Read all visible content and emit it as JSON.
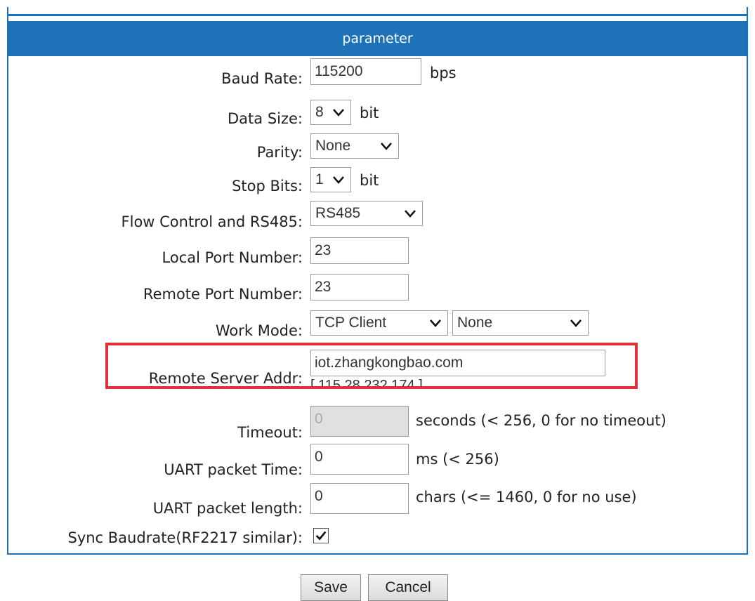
{
  "panel": {
    "title": "parameter"
  },
  "fields": {
    "baud_rate": {
      "label": "Baud Rate:",
      "value": "115200",
      "unit": "bps"
    },
    "data_size": {
      "label": "Data Size:",
      "value": "8",
      "unit": "bit"
    },
    "parity": {
      "label": "Parity:",
      "value": "None"
    },
    "stop_bits": {
      "label": "Stop Bits:",
      "value": "1",
      "unit": "bit"
    },
    "flow_control": {
      "label": "Flow Control and RS485:",
      "value": "RS485"
    },
    "local_port": {
      "label": "Local Port Number:",
      "value": "23"
    },
    "remote_port": {
      "label": "Remote Port Number:",
      "value": "23"
    },
    "work_mode": {
      "label": "Work Mode:",
      "value": "TCP Client",
      "secondary_value": "None"
    },
    "remote_server": {
      "label": "Remote Server Addr:",
      "value": "iot.zhangkongbao.com",
      "resolved": "[ 115.28.232.174 ]"
    },
    "timeout": {
      "label": "Timeout:",
      "value": "0",
      "unit": "seconds (< 256, 0 for no timeout)"
    },
    "uart_time": {
      "label": "UART packet Time:",
      "value": "0",
      "unit": "ms (< 256)"
    },
    "uart_length": {
      "label": "UART packet length:",
      "value": "0",
      "unit": "chars (<= 1460, 0 for no use)"
    },
    "sync_baud": {
      "label": "Sync Baudrate(RF2217 similar):",
      "checked": true
    }
  },
  "buttons": {
    "save": "Save",
    "cancel": "Cancel"
  },
  "colors": {
    "header": "#1e72b8",
    "highlight": "#e0303a"
  }
}
